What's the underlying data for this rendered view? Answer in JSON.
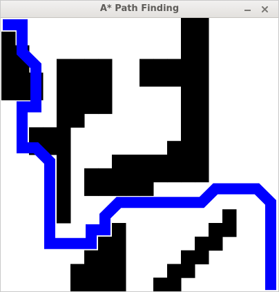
{
  "window": {
    "title": "A* Path Finding",
    "controls": {
      "minimize_icon": "minimize-icon",
      "close_icon": "close-icon"
    }
  },
  "grid": {
    "columns": 20,
    "rows": 20,
    "colors": {
      "empty": "#ffffff",
      "wall": "#000000",
      "path": "#0000ff"
    },
    "walls": [
      [
        0,
        0,
        0,
        0,
        0,
        0,
        0,
        0,
        0,
        0,
        0,
        0,
        0,
        1,
        1,
        0,
        0,
        0,
        0,
        0
      ],
      [
        1,
        0,
        0,
        0,
        0,
        0,
        0,
        0,
        0,
        0,
        0,
        0,
        0,
        1,
        1,
        0,
        0,
        0,
        0,
        0
      ],
      [
        1,
        1,
        0,
        0,
        0,
        0,
        0,
        0,
        0,
        0,
        0,
        0,
        0,
        1,
        1,
        0,
        0,
        0,
        0,
        0
      ],
      [
        1,
        1,
        0,
        0,
        1,
        1,
        1,
        1,
        0,
        0,
        1,
        1,
        1,
        1,
        1,
        0,
        0,
        0,
        0,
        0
      ],
      [
        1,
        1,
        1,
        0,
        1,
        1,
        1,
        1,
        0,
        0,
        1,
        1,
        1,
        1,
        1,
        0,
        0,
        0,
        0,
        0
      ],
      [
        1,
        1,
        1,
        0,
        1,
        1,
        1,
        1,
        0,
        0,
        0,
        0,
        0,
        1,
        1,
        0,
        0,
        0,
        0,
        0
      ],
      [
        0,
        0,
        0,
        0,
        1,
        1,
        1,
        1,
        0,
        0,
        0,
        0,
        0,
        1,
        1,
        0,
        0,
        0,
        0,
        0
      ],
      [
        0,
        0,
        0,
        0,
        1,
        1,
        0,
        0,
        0,
        0,
        0,
        0,
        0,
        1,
        1,
        0,
        0,
        0,
        0,
        0
      ],
      [
        0,
        0,
        1,
        1,
        1,
        0,
        0,
        0,
        0,
        0,
        0,
        0,
        0,
        1,
        1,
        0,
        0,
        0,
        0,
        0
      ],
      [
        0,
        0,
        1,
        1,
        1,
        0,
        0,
        0,
        0,
        0,
        0,
        0,
        1,
        1,
        1,
        0,
        0,
        0,
        0,
        0
      ],
      [
        0,
        0,
        0,
        0,
        1,
        0,
        0,
        0,
        1,
        1,
        1,
        1,
        1,
        1,
        1,
        0,
        0,
        0,
        0,
        0
      ],
      [
        0,
        0,
        0,
        0,
        1,
        0,
        1,
        1,
        1,
        1,
        1,
        1,
        1,
        1,
        1,
        0,
        0,
        0,
        0,
        0
      ],
      [
        0,
        0,
        0,
        0,
        1,
        0,
        1,
        1,
        1,
        1,
        1,
        0,
        0,
        0,
        0,
        0,
        0,
        0,
        0,
        0
      ],
      [
        0,
        0,
        0,
        0,
        1,
        0,
        0,
        0,
        0,
        0,
        0,
        0,
        0,
        0,
        0,
        0,
        0,
        0,
        0,
        0
      ],
      [
        0,
        0,
        0,
        0,
        1,
        0,
        0,
        0,
        0,
        0,
        0,
        0,
        0,
        0,
        0,
        0,
        1,
        0,
        0,
        0
      ],
      [
        0,
        0,
        0,
        0,
        0,
        0,
        0,
        0,
        1,
        0,
        0,
        0,
        0,
        0,
        0,
        1,
        1,
        0,
        0,
        0
      ],
      [
        0,
        0,
        0,
        0,
        0,
        0,
        0,
        1,
        1,
        0,
        0,
        0,
        0,
        0,
        1,
        1,
        0,
        0,
        0,
        0
      ],
      [
        0,
        0,
        0,
        0,
        0,
        0,
        1,
        1,
        1,
        0,
        0,
        0,
        0,
        1,
        1,
        0,
        0,
        0,
        0,
        0
      ],
      [
        0,
        0,
        0,
        0,
        0,
        1,
        1,
        1,
        1,
        0,
        0,
        0,
        1,
        1,
        0,
        0,
        0,
        0,
        0,
        0
      ],
      [
        0,
        0,
        0,
        0,
        0,
        1,
        1,
        1,
        1,
        0,
        0,
        1,
        1,
        0,
        0,
        0,
        0,
        0,
        0,
        0
      ]
    ],
    "path": [
      [
        0,
        0
      ],
      [
        1,
        0
      ],
      [
        1,
        1
      ],
      [
        1,
        2
      ],
      [
        2,
        3
      ],
      [
        2,
        4
      ],
      [
        2,
        5
      ],
      [
        2,
        6
      ],
      [
        1,
        6
      ],
      [
        1,
        7
      ],
      [
        1,
        8
      ],
      [
        1,
        9
      ],
      [
        2,
        9
      ],
      [
        3,
        10
      ],
      [
        3,
        11
      ],
      [
        3,
        12
      ],
      [
        3,
        13
      ],
      [
        3,
        14
      ],
      [
        3,
        15
      ],
      [
        3,
        16
      ],
      [
        4,
        16
      ],
      [
        5,
        16
      ],
      [
        6,
        16
      ],
      [
        6,
        15
      ],
      [
        7,
        15
      ],
      [
        7,
        14
      ],
      [
        8,
        13
      ],
      [
        9,
        13
      ],
      [
        10,
        13
      ],
      [
        11,
        13
      ],
      [
        12,
        13
      ],
      [
        13,
        13
      ],
      [
        14,
        13
      ],
      [
        15,
        12
      ],
      [
        16,
        12
      ],
      [
        17,
        12
      ],
      [
        18,
        12
      ],
      [
        19,
        13
      ],
      [
        19,
        14
      ],
      [
        19,
        15
      ],
      [
        19,
        16
      ],
      [
        19,
        17
      ],
      [
        19,
        18
      ],
      [
        19,
        19
      ]
    ]
  }
}
